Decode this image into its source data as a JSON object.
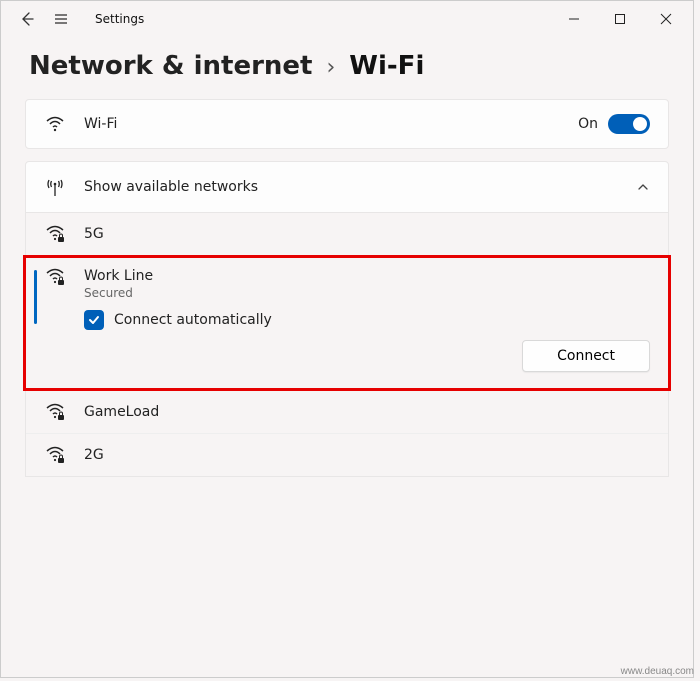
{
  "app_title": "Settings",
  "breadcrumb": {
    "parent": "Network & internet",
    "current": "Wi-Fi"
  },
  "wifi": {
    "label": "Wi-Fi",
    "state_text": "On",
    "enabled": true
  },
  "available": {
    "label": "Show available networks"
  },
  "networks": {
    "n0": {
      "name": "5G"
    },
    "n1": {
      "name": "Work Line",
      "status": "Secured",
      "auto_label": "Connect automatically",
      "auto_checked": true,
      "connect_label": "Connect"
    },
    "n2": {
      "name": "GameLoad"
    },
    "n3": {
      "name": "2G"
    }
  },
  "watermark": "www.deuaq.com"
}
